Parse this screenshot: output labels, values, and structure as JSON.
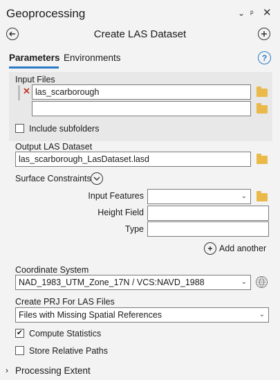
{
  "pane": {
    "title": "Geoprocessing",
    "collapse_icon": "chevron-down-icon",
    "pin_icon": "pin-icon",
    "close_icon": "close-icon"
  },
  "tool": {
    "title": "Create LAS Dataset",
    "back_icon": "back-arrow-icon",
    "add_icon": "plus-icon"
  },
  "tabs": [
    {
      "label": "Parameters",
      "active": true
    },
    {
      "label": "Environments",
      "active": false
    }
  ],
  "help_label": "?",
  "input_files": {
    "label": "Input Files",
    "rows": [
      {
        "value": "las_scarborough"
      },
      {
        "value": ""
      }
    ]
  },
  "include_subfolders": {
    "label": "Include subfolders",
    "checked": false
  },
  "output": {
    "label": "Output LAS Dataset",
    "value": "las_scarborough_LasDataset.lasd"
  },
  "surface_constraints": {
    "label": "Surface Constraints",
    "input_features_label": "Input Features",
    "height_field_label": "Height Field",
    "type_label": "Type",
    "add_another_label": "Add another"
  },
  "coordinate_system": {
    "label": "Coordinate System",
    "value": "NAD_1983_UTM_Zone_17N / VCS:NAVD_1988"
  },
  "create_prj": {
    "label": "Create PRJ For LAS Files",
    "value": "Files with Missing Spatial References"
  },
  "compute_statistics": {
    "label": "Compute Statistics",
    "checked": true
  },
  "store_relative_paths": {
    "label": "Store Relative Paths",
    "checked": false
  },
  "processing_extent": {
    "label": "Processing Extent"
  },
  "colors": {
    "accent": "#2a79c7",
    "folder": "#e9b949",
    "remove": "#c0392b"
  }
}
